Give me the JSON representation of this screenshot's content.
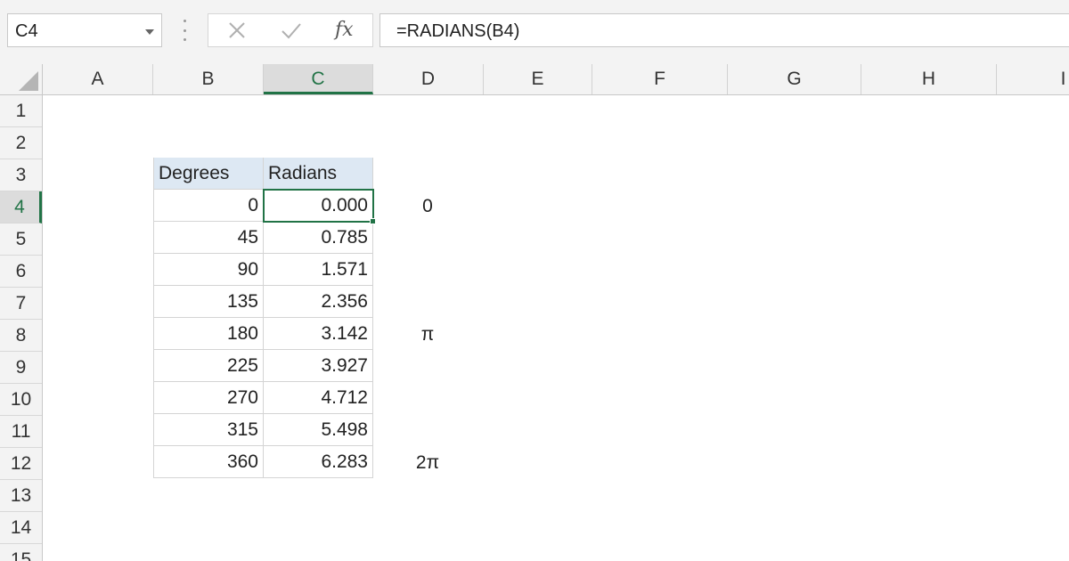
{
  "name_box": {
    "value": "C4"
  },
  "formula": {
    "value": "=RADIANS(B4)"
  },
  "icons": {
    "cancel": "x-icon",
    "enter": "checkmark-icon",
    "function": "fx-icon"
  },
  "columns": [
    "A",
    "B",
    "C",
    "D",
    "E",
    "F",
    "G",
    "H",
    "I"
  ],
  "rows": [
    "1",
    "2",
    "3",
    "4",
    "5",
    "6",
    "7",
    "8",
    "9",
    "10",
    "11",
    "12",
    "13",
    "14",
    "15"
  ],
  "active": {
    "column": "C",
    "row": "4"
  },
  "table": {
    "headers": {
      "degrees": "Degrees",
      "radians": "Radians"
    },
    "rows": [
      {
        "degrees": "0",
        "radians": "0.000"
      },
      {
        "degrees": "45",
        "radians": "0.785"
      },
      {
        "degrees": "90",
        "radians": "1.571"
      },
      {
        "degrees": "135",
        "radians": "2.356"
      },
      {
        "degrees": "180",
        "radians": "3.142"
      },
      {
        "degrees": "225",
        "radians": "3.927"
      },
      {
        "degrees": "270",
        "radians": "4.712"
      },
      {
        "degrees": "315",
        "radians": "5.498"
      },
      {
        "degrees": "360",
        "radians": "6.283"
      }
    ]
  },
  "notes": {
    "d4": "0",
    "d8": "π",
    "d12": "2π"
  },
  "colors": {
    "accent": "#217346",
    "header_fill": "#dde8f3"
  }
}
